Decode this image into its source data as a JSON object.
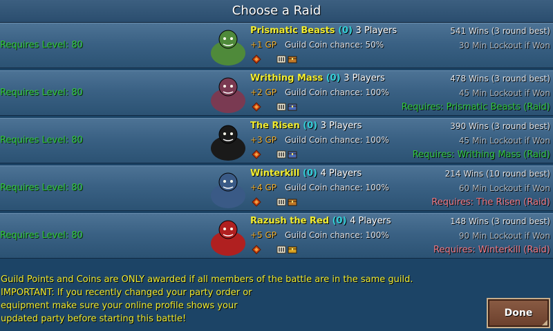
{
  "title": "Choose a Raid",
  "raids": [
    {
      "level": "Requires Level: 80",
      "name": "Prismatic Beasts",
      "count": "(0)",
      "players": "3 Players",
      "gp": "+1 GP",
      "coin": "Guild Coin chance: 50%",
      "wins": "541 Wins (3 round best)",
      "lockout": "30 Min Lockout if Won",
      "requires": "",
      "requires_color": "#32c83e",
      "portrait_color": "#4f8a3a",
      "chest_color": "#c07828"
    },
    {
      "level": "Requires Level: 80",
      "name": "Writhing Mass",
      "count": "(0)",
      "players": "3 Players",
      "gp": "+2 GP",
      "coin": "Guild Coin chance: 100%",
      "wins": "478 Wins (3 round best)",
      "lockout": "45 Min Lockout if Won",
      "requires": "Requires: Prismatic Beasts (Raid)",
      "requires_color": "#32c83e",
      "portrait_color": "#7a3a52",
      "chest_color": "#4a6ab8"
    },
    {
      "level": "Requires Level: 80",
      "name": "The Risen",
      "count": "(0)",
      "players": "3 Players",
      "gp": "+3 GP",
      "coin": "Guild Coin chance: 100%",
      "wins": "390 Wins (3 round best)",
      "lockout": "45 Min Lockout if Won",
      "requires": "Requires: Writhing Mass (Raid)",
      "requires_color": "#32c83e",
      "portrait_color": "#1a1a1a",
      "chest_color": "#4a6ab8"
    },
    {
      "level": "Requires Level: 80",
      "name": "Winterkill",
      "count": "(0)",
      "players": "4 Players",
      "gp": "+4 GP",
      "coin": "Guild Coin chance: 100%",
      "wins": "214 Wins (10 round best)",
      "lockout": "60 Min Lockout if Won",
      "requires": "Requires: The Risen (Raid)",
      "requires_color": "#f07a86",
      "portrait_color": "#3a5a86",
      "chest_color": "#c07828"
    },
    {
      "level": "Requires Level: 80",
      "name": "Razush the Red",
      "count": "(0)",
      "players": "4 Players",
      "gp": "+5 GP",
      "coin": "Guild Coin chance: 100%",
      "wins": "148 Wins (3 round best)",
      "lockout": "90 Min Lockout if Won",
      "requires": "Requires: Winterkill (Raid)",
      "requires_color": "#f07a86",
      "portrait_color": "#b02020",
      "chest_color": "#d8a020"
    }
  ],
  "notes": {
    "line1": "Guild Points and Coins are ONLY awarded if all members of the battle are in the same guild.",
    "line2": "IMPORTANT: If you recently changed your party order or",
    "line3": "equipment make sure your online profile shows your",
    "line4": "updated party before starting this battle!"
  },
  "done_label": "Done"
}
